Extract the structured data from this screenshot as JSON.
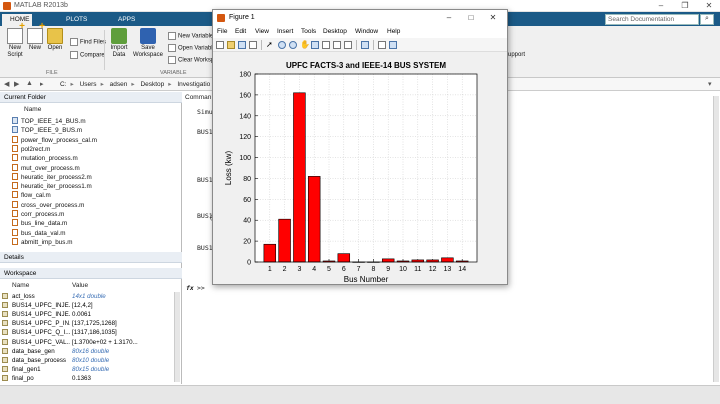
{
  "app": {
    "title": "MATLAB R2013b",
    "tabs": [
      "HOME",
      "PLOTS",
      "APPS"
    ],
    "search_placeholder": "Search Documentation"
  },
  "ribbon": {
    "new_script": "New Script",
    "new": "New",
    "open": "Open",
    "find_files": "Find Files",
    "compare": "Compare",
    "import_data": "Import Data",
    "save_workspace": "Save Workspace",
    "new_variable": "New Variable",
    "open_variable": "Open Variable",
    "clear_workspace": "Clear Workspace",
    "group_file": "FILE",
    "group_variable": "VARIABLE",
    "support": "upport"
  },
  "address": {
    "crumbs": [
      "C:",
      "Users",
      "adsen",
      "Desktop",
      "Investigatio"
    ]
  },
  "current_folder": {
    "header": "Current Folder",
    "col_name": "Name",
    "files": [
      {
        "name": "TOP_IEEE_14_BUS.m",
        "type": "mat"
      },
      {
        "name": "TOP_IEEE_9_BUS.m",
        "type": "mat"
      },
      {
        "name": "power_flow_process_cal.m",
        "type": "m"
      },
      {
        "name": "pol2rect.m",
        "type": "m"
      },
      {
        "name": "mutation_process.m",
        "type": "m"
      },
      {
        "name": "mut_over_process.m",
        "type": "m"
      },
      {
        "name": "heuratic_iter_process2.m",
        "type": "m"
      },
      {
        "name": "heuratic_iter_process1.m",
        "type": "m"
      },
      {
        "name": "flow_cal.m",
        "type": "m"
      },
      {
        "name": "cross_over_process.m",
        "type": "m"
      },
      {
        "name": "corr_process.m",
        "type": "m"
      },
      {
        "name": "bus_line_data.m",
        "type": "m"
      },
      {
        "name": "bus_data_val.m",
        "type": "m"
      },
      {
        "name": "abmitt_imp_bus.m",
        "type": "m"
      }
    ]
  },
  "details": {
    "header": "Details"
  },
  "workspace": {
    "header": "Workspace",
    "col_name": "Name",
    "col_value": "Value",
    "vars": [
      {
        "name": "act_loss",
        "value": "14x1 double",
        "ital": true
      },
      {
        "name": "BUS14_UPFC_INJE...",
        "value": "[12,4,2]",
        "ital": false
      },
      {
        "name": "BUS14_UPFC_INJE...",
        "value": "0.0061",
        "ital": false
      },
      {
        "name": "BUS14_UPFC_P_IN...",
        "value": "[137,1725,1268]",
        "ital": false
      },
      {
        "name": "BUS14_UPFC_Q_I...",
        "value": "[1317,186,1035]",
        "ital": false
      },
      {
        "name": "BUS14_UPFC_VAL...",
        "value": "[1.3700e+02 + 1.3170...",
        "ital": false
      },
      {
        "name": "data_base_gen",
        "value": "80x16 double",
        "ital": true
      },
      {
        "name": "data_base_process",
        "value": "80x10 double",
        "ital": true
      },
      {
        "name": "final_gen1",
        "value": "80x15 double",
        "ital": true
      },
      {
        "name": "final_po",
        "value": "0.1363",
        "ital": false
      }
    ]
  },
  "command_window": {
    "header": "Comman",
    "lines": [
      "Simu",
      "BUS1",
      "BUS1",
      "(",
      "BUS1",
      "BUS1"
    ],
    "prompt_fx": "fx",
    "prompt": ">>"
  },
  "figure": {
    "title": "Figure 1",
    "menu": [
      "File",
      "Edit",
      "View",
      "Insert",
      "Tools",
      "Desktop",
      "Window",
      "Help"
    ]
  },
  "chart_data": {
    "type": "bar",
    "title": "UPFC FACTS-3 and IEEE-14 BUS SYSTEM",
    "xlabel": "Bus Number",
    "ylabel": "Loss (kw)",
    "categories": [
      "1",
      "2",
      "3",
      "4",
      "5",
      "6",
      "7",
      "8",
      "9",
      "10",
      "11",
      "12",
      "13",
      "14"
    ],
    "values": [
      17,
      41,
      162,
      82,
      1,
      8,
      0,
      0,
      3,
      1,
      2,
      2,
      4,
      1
    ],
    "ylim": [
      0,
      180
    ],
    "yticks": [
      0,
      20,
      40,
      60,
      80,
      100,
      120,
      140,
      160,
      180
    ],
    "grid": true,
    "bar_color": "#ff0000"
  }
}
